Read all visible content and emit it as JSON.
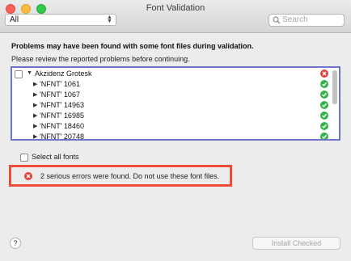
{
  "window": {
    "title": "Font Validation"
  },
  "toolbar": {
    "filter_value": "All",
    "search_placeholder": "Search"
  },
  "content": {
    "heading": "Problems may have been found with some font files during validation.",
    "subheading": "Please review the reported problems before continuing."
  },
  "tree": {
    "root": {
      "label": "Akzidenz Grotesk",
      "status": "error"
    },
    "items": [
      {
        "label": "'NFNT' 1061",
        "status": "ok"
      },
      {
        "label": "'NFNT' 1067",
        "status": "ok"
      },
      {
        "label": "'NFNT' 14963",
        "status": "ok"
      },
      {
        "label": "'NFNT' 16985",
        "status": "ok"
      },
      {
        "label": "'NFNT' 18460",
        "status": "ok"
      },
      {
        "label": "'NFNT' 20748",
        "status": "ok"
      }
    ]
  },
  "select_all": {
    "label": "Select all fonts"
  },
  "error": {
    "message": "2 serious errors were found. Do not use these font files."
  },
  "footer": {
    "help_label": "?",
    "install_label": "Install Checked"
  },
  "colors": {
    "error_red": "#e0443b",
    "ok_green": "#35b24a",
    "highlight_blue": "#6f74c9",
    "highlight_red": "#ef4a36"
  }
}
